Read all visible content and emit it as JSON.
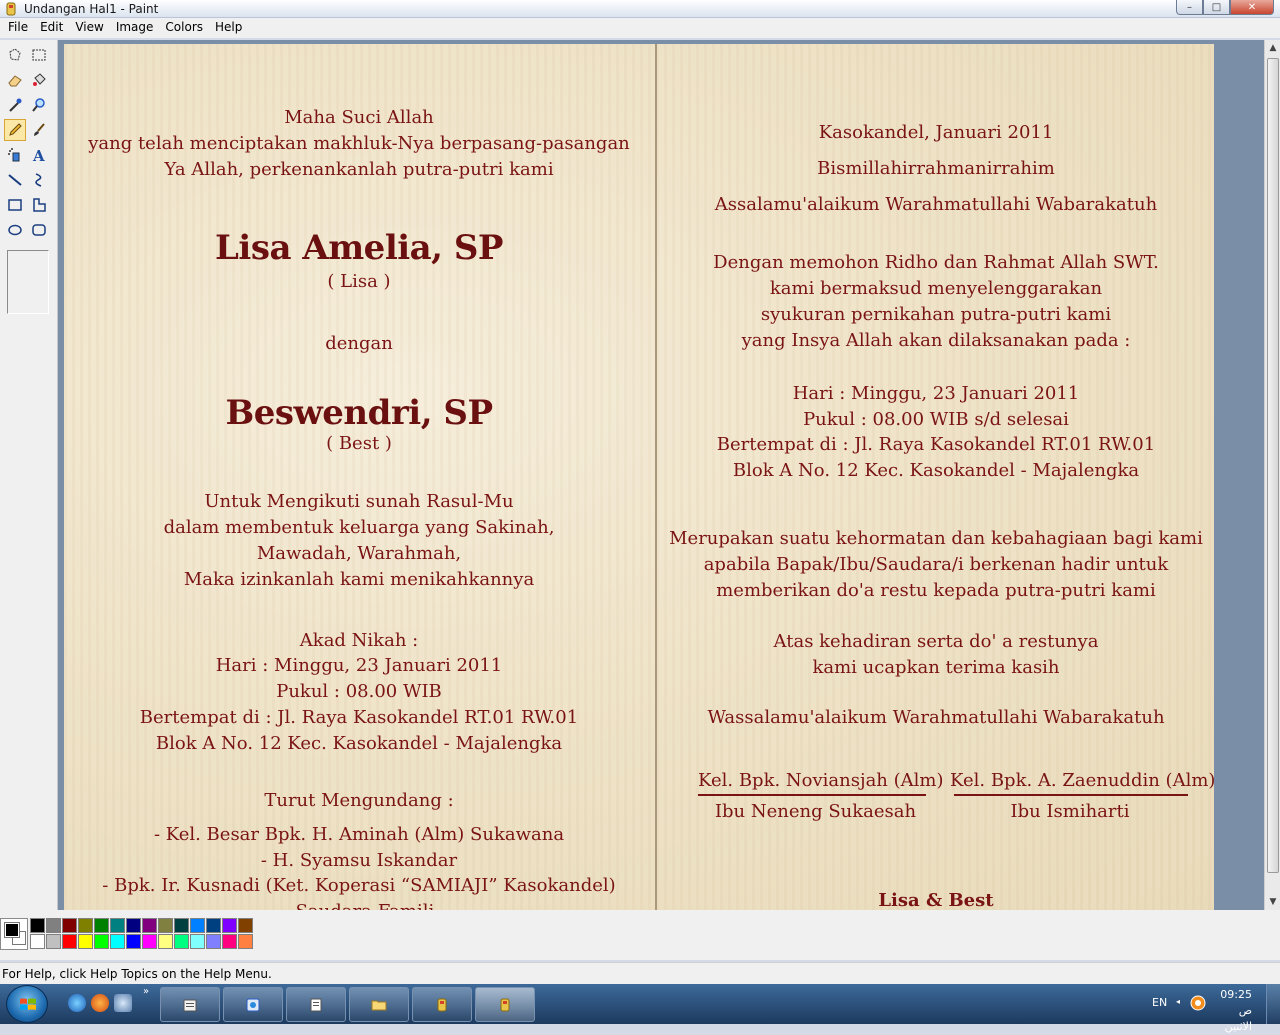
{
  "window": {
    "title": "Undangan Hal1 - Paint",
    "minimize": "–",
    "maximize": "□",
    "close": "✕"
  },
  "menu": [
    "File",
    "Edit",
    "View",
    "Image",
    "Colors",
    "Help"
  ],
  "tools": [
    {
      "name": "free-form-select-icon"
    },
    {
      "name": "rect-select-icon"
    },
    {
      "name": "eraser-icon"
    },
    {
      "name": "fill-bucket-icon"
    },
    {
      "name": "color-picker-icon"
    },
    {
      "name": "magnifier-icon"
    },
    {
      "name": "pencil-icon",
      "active": true
    },
    {
      "name": "brush-icon"
    },
    {
      "name": "airbrush-icon"
    },
    {
      "name": "text-icon"
    },
    {
      "name": "line-icon"
    },
    {
      "name": "curve-icon"
    },
    {
      "name": "rectangle-icon"
    },
    {
      "name": "polygon-icon"
    },
    {
      "name": "ellipse-icon"
    },
    {
      "name": "rounded-rect-icon"
    }
  ],
  "invitation": {
    "left": {
      "opening": [
        "Maha Suci Allah",
        "yang telah menciptakan makhluk-Nya berpasang-pasangan",
        "Ya Allah, perkenankanlah putra-putri kami"
      ],
      "bride_name": "Lisa Amelia, SP",
      "bride_nick": "( Lisa )",
      "conjunction": "dengan",
      "groom_name": "Beswendri, SP",
      "groom_nick": "( Best )",
      "purpose": [
        "Untuk Mengikuti sunah Rasul-Mu",
        "dalam membentuk  keluarga yang Sakinah,",
        "Mawadah, Warahmah,",
        "Maka izinkanlah kami menikahkannya"
      ],
      "akad": [
        "Akad Nikah :",
        "Hari : Minggu, 23 Januari 2011",
        "Pukul : 08.00 WIB",
        "Bertempat di : Jl. Raya Kasokandel RT.01 RW.01",
        "Blok A No. 12 Kec. Kasokandel - Majalengka"
      ],
      "turut_title": "Turut Mengundang :",
      "turut": [
        "- Kel. Besar Bpk. H. Aminah (Alm) Sukawana",
        "- H. Syamsu Iskandar",
        "- Bpk. Ir. Kusnadi (Ket. Koperasi “SAMIAJI” Kasokandel)",
        "- Saudara-Famili"
      ]
    },
    "right": {
      "place_date": "Kasokandel, Januari 2011",
      "basmalah": "Bismillahirrahmanirrahim",
      "salam": "Assalamu'alaikum Warahmatullahi Wabarakatuh",
      "intro": [
        "Dengan memohon Ridho dan Rahmat Allah SWT.",
        "kami bermaksud menyelenggarakan",
        "syukuran pernikahan putra-putri kami",
        "yang Insya Allah akan dilaksanakan pada :"
      ],
      "event": [
        "Hari : Minggu, 23 Januari 2011",
        "Pukul : 08.00 WIB s/d selesai",
        "Bertempat di : Jl. Raya Kasokandel RT.01 RW.01",
        "Blok A No. 12 Kec. Kasokandel - Majalengka"
      ],
      "honor": [
        "Merupakan suatu kehormatan dan kebahagiaan bagi kami",
        "apabila Bapak/Ibu/Saudara/i berkenan hadir untuk",
        "memberikan do'a restu kepada putra-putri kami"
      ],
      "thanks": [
        "Atas kehadiran serta do' a restunya",
        "kami ucapkan terima kasih"
      ],
      "closing": "Wassalamu'alaikum Warahmatullahi Wabarakatuh",
      "family1_father": "Kel. Bpk. Noviansjah (Alm)",
      "family1_mother": "Ibu Neneng Sukaesah",
      "family2_father": "Kel. Bpk. A. Zaenuddin (Alm)",
      "family2_mother": "Ibu Ismiharti",
      "couple": "Lisa & Best"
    }
  },
  "palette": {
    "foreground": "#000000",
    "background": "#ffffff",
    "colors": [
      "#000000",
      "#808080",
      "#800000",
      "#808000",
      "#008000",
      "#008080",
      "#000080",
      "#800080",
      "#808040",
      "#004040",
      "#0080ff",
      "#004080",
      "#8000ff",
      "#804000",
      "#ffffff",
      "#c0c0c0",
      "#ff0000",
      "#ffff00",
      "#00ff00",
      "#00ffff",
      "#0000ff",
      "#ff00ff",
      "#ffff80",
      "#00ff80",
      "#80ffff",
      "#8080ff",
      "#ff0080",
      "#ff8040"
    ]
  },
  "status": "For Help, click Help Topics on the Help Menu.",
  "taskbar": {
    "quick_launch_more": "»",
    "tasks": [
      {
        "name": "explorer-folder-icon"
      },
      {
        "name": "ie-window-icon"
      },
      {
        "name": "document-window-icon"
      },
      {
        "name": "folder-window-icon"
      },
      {
        "name": "paint-window-icon"
      },
      {
        "name": "paint-window-icon-active",
        "active": true
      }
    ],
    "language": "EN",
    "tray_arrow": "◂",
    "time": "09:25 ص",
    "day": "الاثنين"
  }
}
